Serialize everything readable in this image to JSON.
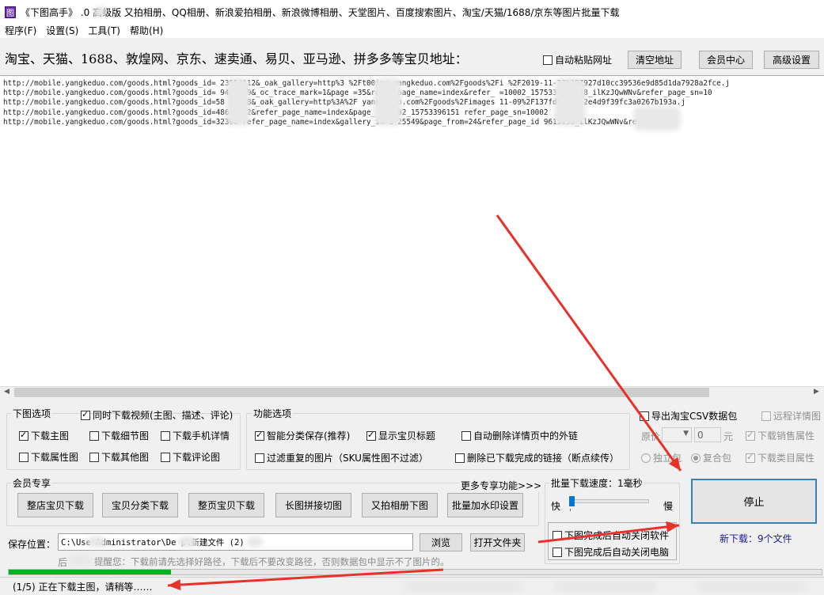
{
  "title": {
    "icon_letter": "图",
    "text": "《下图高手》 .0 高级版 又拍相册、QQ相册、新浪爱拍相册、新浪微博相册、天堂图片、百度搜索图片、淘宝/天猫/1688/京东等图片批量下载"
  },
  "menu": [
    "程序(F)",
    "设置(S)",
    "工具(T)",
    "帮助(H)"
  ],
  "header": {
    "label": "淘宝、天猫、1688、敦煌网、京东、速卖通、易贝、亚马逊、拼多多等宝贝地址：",
    "auto_paste": "自动粘贴网址",
    "clear_btn": "清空地址",
    "member_btn": "会员中心",
    "advanced_btn": "高级设置"
  },
  "urls": [
    "http://mobile.yangkeduo.com/goods.html?goods_id=  23554112&_oak_gallery=http%3     %2Ft00img.yangkeduo.com%2Fgoods%2Fi      %2F2019-11-27%2F7927d10cc39536e9d85d1da7928a2fce.j",
    "http://mobile.yangkeduo.com/goods.html?goods_id=  9455949&_oc_trace_mark=1&page      =35&refer_page_name=index&refer_       =10002_1575339615158_ilKzJQwWNv&refer_page_sn=10",
    "http://mobile.yangkeduo.com/goods.html?goods_id=58    39738&_oak_gallery=http%3A%2F   yangkeduo.com%2Fgoods%2Fimages     11-09%2F137fd5e37812e4d9f39fc3a0267b193a.j",
    "http://mobile.yangkeduo.com/goods.html?goods_id=4864   722&refer_page_name=index&page_          _10002_15753396151      refer_page_sn=10002",
    "http://mobile.yangkeduo.com/goods.html?goods_id=32308     refer_page_name=index&gallery_id=1        25549&page_from=24&refer_page_id      9615158_ilKzJQwWNv&refer_pag"
  ],
  "download_opts": {
    "title": "下图选项",
    "video": "同时下载视频(主图、描述、评论)",
    "items": [
      "下载主图",
      "下载细节图",
      "下载手机详情",
      "下载属性图",
      "下载其他图",
      "下载评论图"
    ]
  },
  "func_opts": {
    "title": "功能选项",
    "items": [
      "智能分类保存(推荐)",
      "显示宝贝标题",
      "自动删除详情页中的外链",
      "过滤重复的图片（SKU属性图不过滤）",
      "删除已下载完成的链接（断点续传）"
    ]
  },
  "right_opts": {
    "export_csv": "导出淘宝CSV数据包",
    "remote_detail": "远程详情图",
    "price_label": "原价",
    "price_op": "",
    "price_value": "0",
    "price_unit": "元",
    "sales_attr": "下载销售属性",
    "indep": "独立包",
    "composite": "复合包",
    "category_attr": "下载类目属性"
  },
  "member": {
    "title": "会员专享",
    "more": "更多专享功能>>>",
    "buttons": [
      "整店宝贝下载",
      "宝贝分类下载",
      "整页宝贝下载",
      "长图拼接切图",
      "又拍相册下图",
      "批量加水印设置"
    ]
  },
  "speed": {
    "label": "批量下载速度：1毫秒",
    "fast": "快",
    "slow": "慢",
    "after_close_app": "下图完成后自动关闭软件",
    "after_shutdown": "下图完成后自动关闭电脑"
  },
  "stop_btn": "停止",
  "new_download": "新下载：9个文件",
  "save": {
    "label": "保存位置：",
    "path": "C:\\Use    Administrator\\De     p\\新建文件    (2)",
    "browse": "浏览",
    "open_folder": "打开文件夹"
  },
  "tip": "提醒您：下载前请先选择好路径，下载后不要改变路径，否则数据包中显示不了图片的。",
  "tip_prefix": "后",
  "progress": 0.2,
  "status": "(1/5) 正在下载主图，请稍等……",
  "colors": {
    "progress": "#06b025",
    "arrow": "#e8312a",
    "new_download": "#1a1a9a"
  }
}
